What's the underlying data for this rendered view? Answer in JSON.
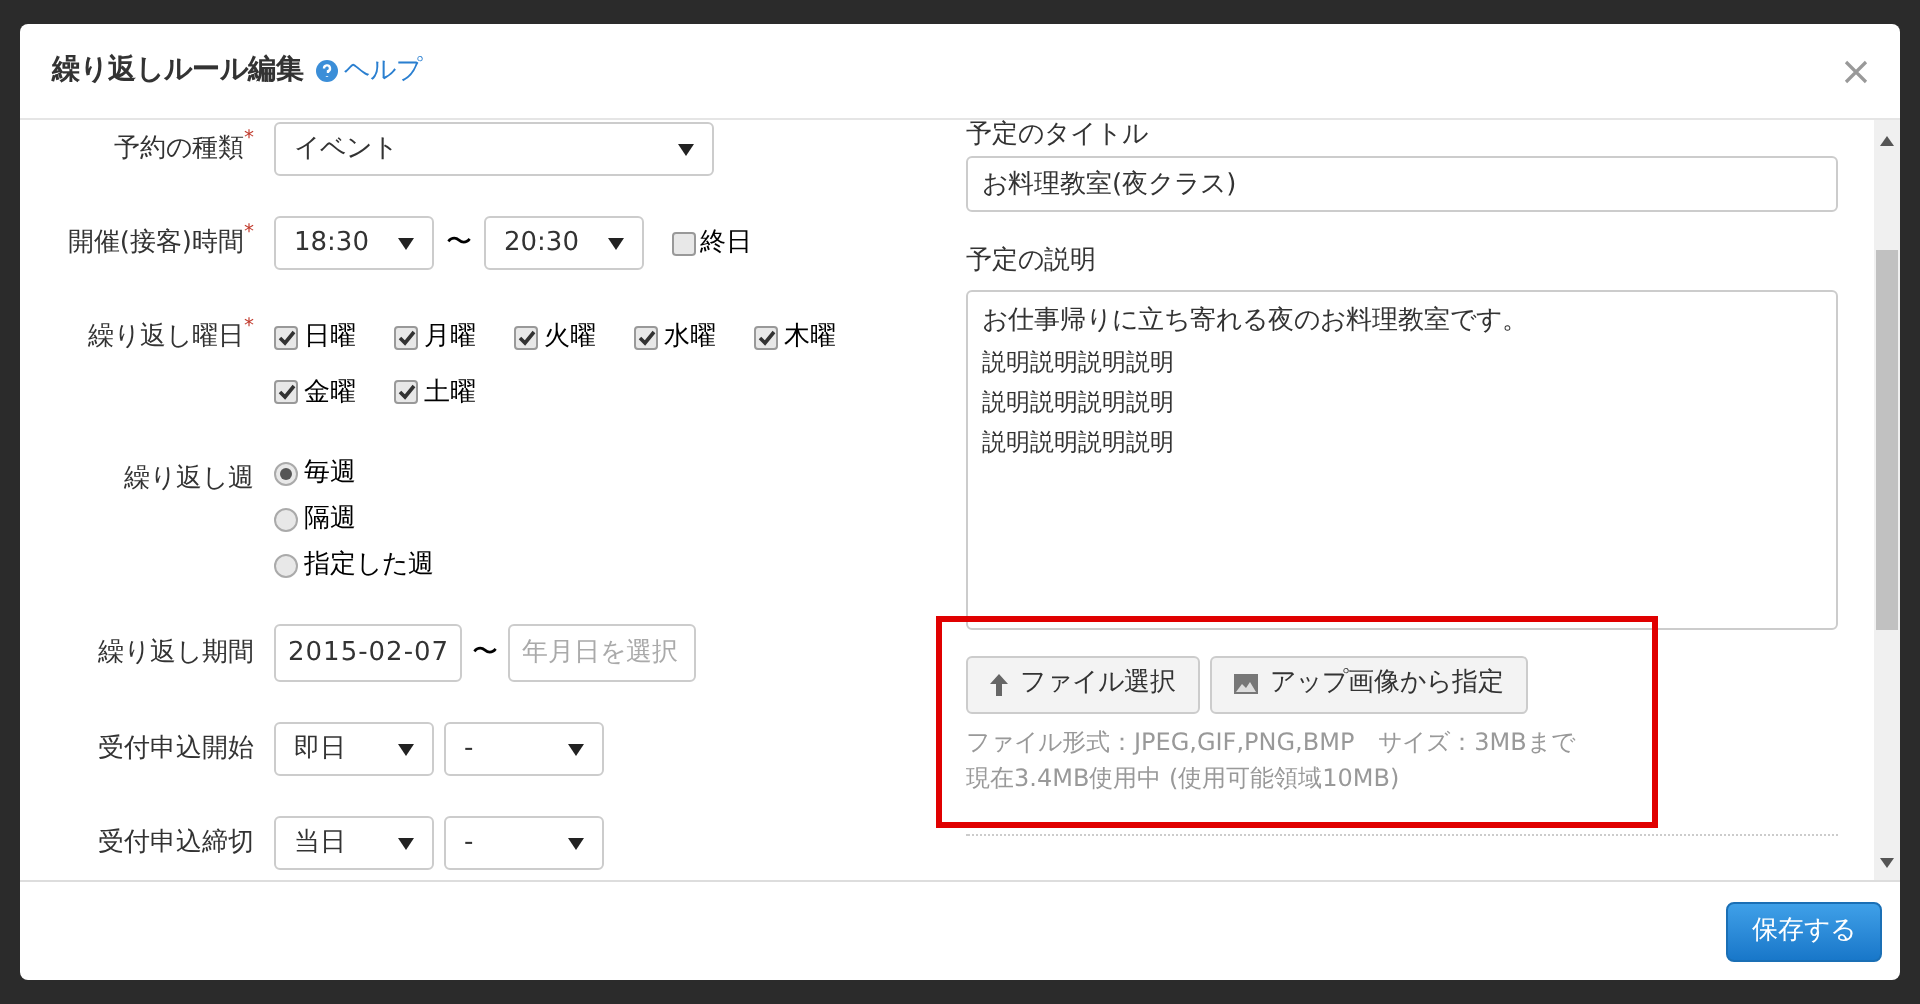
{
  "dialog": {
    "title": "繰り返しルール編集",
    "help_link": "ヘルプ"
  },
  "left_fields": [
    {
      "kind": "select",
      "label": "予約の種類",
      "required_mark": "*",
      "value": "イベント"
    },
    {
      "kind": "time_range",
      "label": "開催(接客)時間",
      "required_mark": "*",
      "start": "18:30",
      "separator": "〜",
      "end": "20:30",
      "all_day": {
        "label": "終日",
        "checked": false
      }
    },
    {
      "kind": "checkbox_group",
      "label": "繰り返し曜日",
      "required_mark": "*",
      "options": [
        {
          "label": "日曜",
          "checked": true
        },
        {
          "label": "月曜",
          "checked": true
        },
        {
          "label": "火曜",
          "checked": true
        },
        {
          "label": "水曜",
          "checked": true
        },
        {
          "label": "木曜",
          "checked": true
        },
        {
          "label": "金曜",
          "checked": true
        },
        {
          "label": "土曜",
          "checked": true
        }
      ]
    },
    {
      "kind": "radio_group",
      "label": "繰り返し週",
      "options": [
        {
          "label": "毎週",
          "selected": true
        },
        {
          "label": "隔週",
          "selected": false
        },
        {
          "label": "指定した週",
          "selected": false
        }
      ]
    },
    {
      "kind": "date_range",
      "label": "繰り返し期間",
      "start": "2015-02-07",
      "separator": "〜",
      "end_placeholder": "年月日を選択"
    },
    {
      "kind": "select_pair",
      "label": "受付申込開始",
      "first": "即日",
      "second": "-"
    },
    {
      "kind": "select_pair",
      "label": "受付申込締切",
      "first": "当日",
      "second": "-"
    }
  ],
  "right": {
    "title_label": "予定のタイトル",
    "title_value": "お料理教室(夜クラス)",
    "description_label": "予定の説明",
    "description_lines": [
      "お仕事帰りに立ち寄れる夜のお料理教室です。",
      "説明説明説明説明",
      "説明説明説明説明",
      "説明説明説明説明"
    ],
    "upload_buttons": [
      {
        "kind": "upload",
        "label": "ファイル選択"
      },
      {
        "kind": "image",
        "label": "アップ画像から指定"
      }
    ],
    "notes": [
      "ファイル形式：JPEG,GIF,PNG,BMP　サイズ：3MBまで",
      "現在3.4MB使用中 (使用可能領域10MB)"
    ]
  },
  "footer": {
    "save_button": "保存する"
  }
}
